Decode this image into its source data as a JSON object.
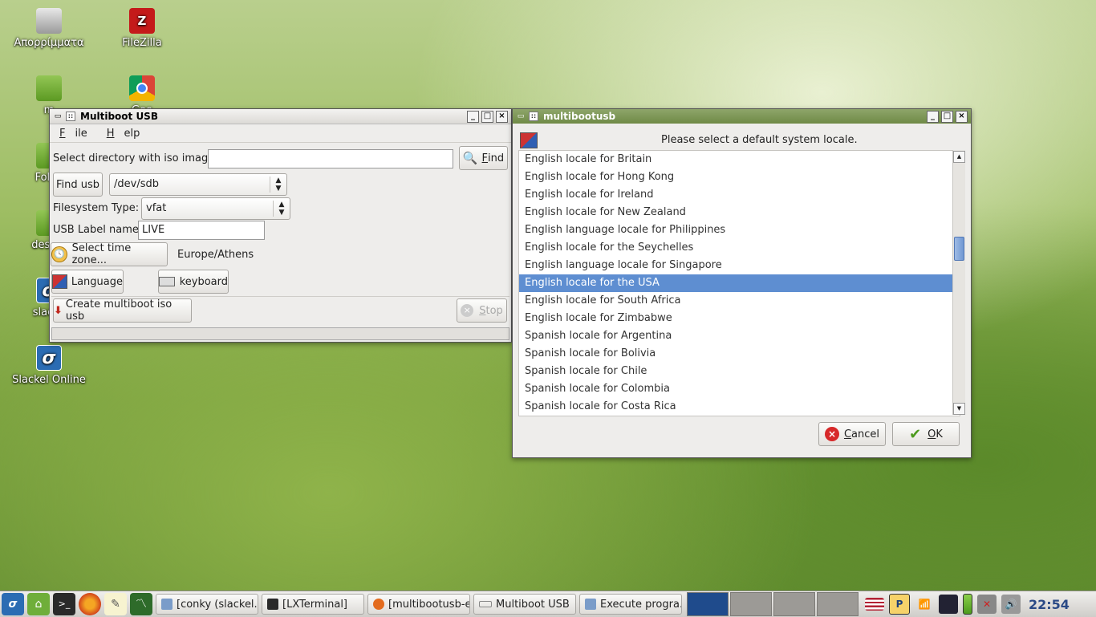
{
  "desktop": {
    "icons": [
      {
        "label": "Απορρίμματα",
        "icon": "trash-icon"
      },
      {
        "label": "FileZilla",
        "icon": "filezilla-icon"
      },
      {
        "label": "m",
        "icon": "folder-icon"
      },
      {
        "label": "Goo",
        "icon": "chrome-icon"
      },
      {
        "label": "Folde",
        "icon": "folder-icon"
      },
      {
        "label": "deskto",
        "icon": "folder-icon"
      },
      {
        "label": "slacke",
        "icon": "slackel-icon"
      },
      {
        "label": "Slackel Online",
        "icon": "slackel-icon"
      }
    ]
  },
  "win_multiboot": {
    "title": "Multiboot USB",
    "menu": {
      "file": "File",
      "file_key": "F",
      "file_rest": "ile",
      "help_key": "H",
      "help_rest": "elp"
    },
    "iso_label": "Select directory with iso images:",
    "iso_value": "",
    "find_key": "F",
    "find_rest": "ind",
    "find_usb": "Find usb",
    "usb_device": "/dev/sdb",
    "fs_label": "Filesystem Type:",
    "fs_value": "vfat",
    "usb_label_label": "USB Label name:",
    "usb_label_value": "LIVE",
    "timezone_btn": "Select time zone...",
    "timezone_value": "Europe/Athens",
    "language_btn": "Language",
    "keyboard_btn": "keyboard",
    "create_btn": "Create multiboot iso usb",
    "stop_key": "S",
    "stop_rest": "top"
  },
  "win_locale": {
    "title": "multibootusb",
    "prompt": "Please select a default system locale.",
    "items": [
      "English locale for Britain",
      "English locale for Hong Kong",
      "English locale for Ireland",
      "English locale for New Zealand",
      "English language locale for Philippines",
      "English locale for the Seychelles",
      "English language locale for Singapore",
      "English locale for the USA",
      "English locale for South Africa",
      "English locale for Zimbabwe",
      "Spanish locale for Argentina",
      "Spanish locale for Bolivia",
      "Spanish locale for Chile",
      "Spanish locale for Colombia",
      "Spanish locale for Costa Rica"
    ],
    "selected_index": 7,
    "cancel_key": "C",
    "cancel_rest": "ancel",
    "ok_key": "O",
    "ok_rest": "K"
  },
  "taskbar": {
    "tasks": [
      "[conky (slackel....",
      "[LXTerminal]",
      "[multibootusb-e...",
      "Multiboot USB",
      "Execute progra..."
    ],
    "clock": "22:54"
  },
  "colors": {
    "selection": "#5e8ed1",
    "title_active": "#7a9450",
    "clock": "#2b4a86"
  }
}
